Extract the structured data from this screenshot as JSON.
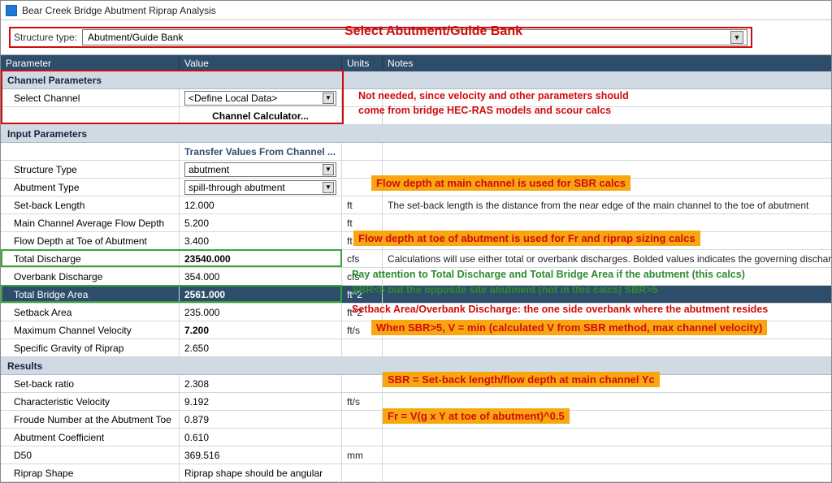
{
  "window": {
    "title": "Bear Creek Bridge Abutment Riprap Analysis"
  },
  "structure_type": {
    "label": "Structure type:",
    "value": "Abutment/Guide Bank"
  },
  "anno": {
    "top": "Select Abutment/Guide Bank",
    "ch_note_l1": "Not needed, since velocity and other parameters should",
    "ch_note_l2": "come from bridge HEC-RAS models and scour calcs",
    "flow_depth_mc": "Flow depth at main channel is used for SBR calcs",
    "flow_depth_toe": "Flow depth at toe of abutment is used for Fr and riprap sizing calcs",
    "pay_l1": "Pay attention to Total Discharge and Total Bridge Area if the abutment (this calcs)",
    "pay_l2": "SBR<5 but the opposite site abutment (not in this calcs) SBR>5",
    "setback_over": "Setback Area/Overbank Discharge: the one side overbank where the abutment resides",
    "sbr5v": "When SBR>5, V = min (calculated V from SBR method, max channel velocity)",
    "sbr_eq": "SBR = Set-back length/flow depth at main channel Yc",
    "fr_eq": "Fr = V(g x Y at toe of abutment)^0.5"
  },
  "headers": {
    "param": "Parameter",
    "value": "Value",
    "units": "Units",
    "notes": "Notes"
  },
  "sections": {
    "ch": "Channel Parameters",
    "inp": "Input Parameters",
    "res": "Results"
  },
  "ch": {
    "select_channel_label": "Select Channel",
    "select_channel_value": "<Define Local Data>",
    "calc_link": "Channel Calculator..."
  },
  "inp": {
    "transfer": "Transfer Values From Channel ...",
    "structure_type": {
      "p": "Structure Type",
      "v": "abutment"
    },
    "abutment_type": {
      "p": "Abutment Type",
      "v": "spill-through abutment"
    },
    "setback_len": {
      "p": "Set-back Length",
      "v": "12.000",
      "u": "ft"
    },
    "mc_depth": {
      "p": "Main Channel Average Flow Depth",
      "v": "5.200",
      "u": "ft"
    },
    "toe_depth": {
      "p": "Flow Depth at Toe of Abutment",
      "v": "3.400",
      "u": "ft"
    },
    "total_q": {
      "p": "Total Discharge",
      "v": "23540.000",
      "u": "cfs",
      "n": "Calculations will use either total or overbank discharges.  Bolded values indicates the governing discharge"
    },
    "over_q": {
      "p": "Overbank Discharge",
      "v": "354.000",
      "u": "cfs"
    },
    "bridge_area": {
      "p": "Total Bridge Area",
      "v": "2561.000",
      "u": "ft^2"
    },
    "setback_area": {
      "p": "Setback Area",
      "v": "235.000",
      "u": "ft^2"
    },
    "max_v": {
      "p": "Maximum Channel Velocity",
      "v": "7.200",
      "u": "ft/s"
    },
    "sg": {
      "p": "Specific Gravity of Riprap",
      "v": "2.650"
    },
    "setback_note": "The set-back length is the distance from the near edge of the main channel to the toe of abutment"
  },
  "res": {
    "sbr": {
      "p": "Set-back ratio",
      "v": "2.308"
    },
    "char_v": {
      "p": "Characteristic Velocity",
      "v": "9.192",
      "u": "ft/s"
    },
    "froude": {
      "p": "Froude Number at the Abutment Toe",
      "v": "0.879"
    },
    "abut_coef": {
      "p": "Abutment Coefficient",
      "v": "0.610"
    },
    "d50": {
      "p": "D50",
      "v": "369.516",
      "u": "mm"
    },
    "shape": {
      "p": "Riprap Shape",
      "v": "Riprap shape should be angular"
    }
  }
}
